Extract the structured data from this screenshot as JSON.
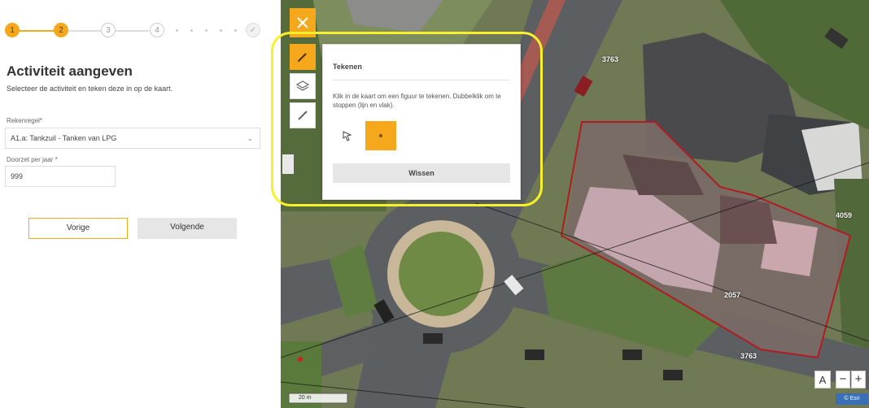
{
  "stepper": {
    "steps": [
      "1",
      "2",
      "3",
      "4",
      "✓"
    ]
  },
  "left": {
    "title": "Activiteit aangeven",
    "subtitle": "Selecteer de activiteit en teken deze in op de kaart.",
    "activity_label": "Rekenregel*",
    "activity_value": "A1.a: Tankzuil - Tanken van LPG",
    "throughput_label": "Doorzet per jaar *",
    "throughput_value": "999",
    "prev_button": "Vorige",
    "next_button": "Volgende"
  },
  "popup": {
    "title": "Tekenen",
    "instructions": "Klik in de kaart om een figuur te tekenen. Dubbelklik om te stoppen (lijn en vlak).",
    "clear_button": "Wissen"
  },
  "map": {
    "parcel_labels": [
      "3763",
      "4059",
      "2057",
      "3763"
    ],
    "scale_label": "20 m",
    "attribution": "© Esri",
    "zoom_in": "+",
    "zoom_out": "−",
    "layer_toggle": "A"
  },
  "colors": {
    "accent": "#f5a81c",
    "highlight": "#f7f02a",
    "parcel": "#b01c22"
  }
}
